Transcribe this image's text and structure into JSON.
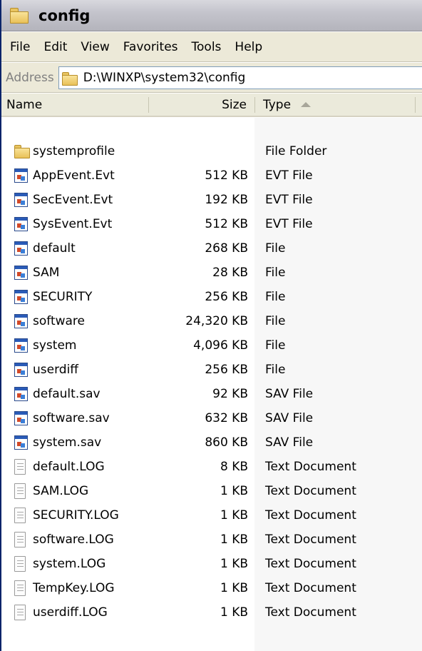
{
  "window": {
    "title": "config",
    "title_icon": "folder-icon"
  },
  "menu": [
    "File",
    "Edit",
    "View",
    "Favorites",
    "Tools",
    "Help"
  ],
  "address": {
    "label": "Address",
    "path": "D:\\WINXP\\system32\\config",
    "icon": "folder-icon"
  },
  "columns": {
    "name": "Name",
    "size": "Size",
    "type": "Type",
    "sort": "ascending"
  },
  "files": [
    {
      "name": "systemprofile",
      "size": "",
      "type": "File Folder",
      "icon": "folder"
    },
    {
      "name": "AppEvent.Evt",
      "size": "512 KB",
      "type": "EVT File",
      "icon": "app"
    },
    {
      "name": "SecEvent.Evt",
      "size": "192 KB",
      "type": "EVT File",
      "icon": "app"
    },
    {
      "name": "SysEvent.Evt",
      "size": "512 KB",
      "type": "EVT File",
      "icon": "app"
    },
    {
      "name": "default",
      "size": "268 KB",
      "type": "File",
      "icon": "app"
    },
    {
      "name": "SAM",
      "size": "28 KB",
      "type": "File",
      "icon": "app"
    },
    {
      "name": "SECURITY",
      "size": "256 KB",
      "type": "File",
      "icon": "app"
    },
    {
      "name": "software",
      "size": "24,320 KB",
      "type": "File",
      "icon": "app"
    },
    {
      "name": "system",
      "size": "4,096 KB",
      "type": "File",
      "icon": "app"
    },
    {
      "name": "userdiff",
      "size": "256 KB",
      "type": "File",
      "icon": "app"
    },
    {
      "name": "default.sav",
      "size": "92 KB",
      "type": "SAV File",
      "icon": "app"
    },
    {
      "name": "software.sav",
      "size": "632 KB",
      "type": "SAV File",
      "icon": "app"
    },
    {
      "name": "system.sav",
      "size": "860 KB",
      "type": "SAV File",
      "icon": "app"
    },
    {
      "name": "default.LOG",
      "size": "8 KB",
      "type": "Text Document",
      "icon": "text"
    },
    {
      "name": "SAM.LOG",
      "size": "1 KB",
      "type": "Text Document",
      "icon": "text"
    },
    {
      "name": "SECURITY.LOG",
      "size": "1 KB",
      "type": "Text Document",
      "icon": "text"
    },
    {
      "name": "software.LOG",
      "size": "1 KB",
      "type": "Text Document",
      "icon": "text"
    },
    {
      "name": "system.LOG",
      "size": "1 KB",
      "type": "Text Document",
      "icon": "text"
    },
    {
      "name": "TempKey.LOG",
      "size": "1 KB",
      "type": "Text Document",
      "icon": "text"
    },
    {
      "name": "userdiff.LOG",
      "size": "1 KB",
      "type": "Text Document",
      "icon": "text"
    }
  ],
  "colors": {
    "titlebar": "#c4c4cc",
    "menubar": "#ece9d8",
    "folder_yellow": "#e9c159",
    "sorted_column_bg": "#f7f7f7"
  }
}
